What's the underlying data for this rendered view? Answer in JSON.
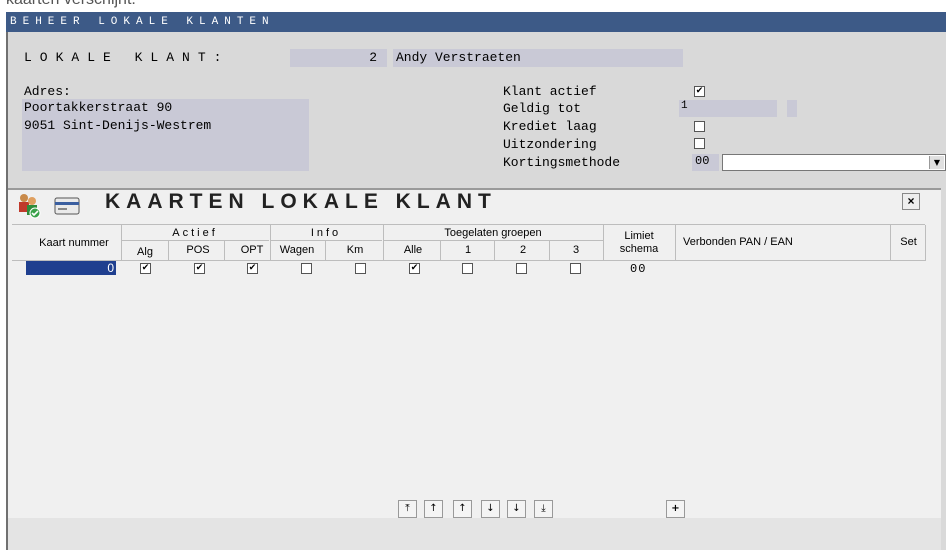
{
  "top_caption": "kaarten verschijnt.",
  "window": {
    "title": "BEHEER LOKALE KLANTEN"
  },
  "customer": {
    "label": "LOKALE KLANT:",
    "number": "2",
    "name": "Andy Verstraeten",
    "address_label": "Adres:",
    "address_line1": "Poortakkerstraat 90",
    "address_line2": "9051 Sint-Denijs-Westrem"
  },
  "flags": {
    "active_label": "Klant actief",
    "active_checked": "✔",
    "valid_until_label": "Geldig tot",
    "valid_until_value": "1",
    "credit_low_label": "Krediet laag",
    "credit_low_checked": "",
    "exception_label": "Uitzondering",
    "exception_checked": "",
    "discount_label": "Kortingsmethode",
    "discount_code": "00",
    "discount_value": ""
  },
  "cards_panel": {
    "title": "KAARTEN LOKALE KLANT",
    "close": "×",
    "headers": {
      "card_number": "Kaart nummer",
      "actief": "Actief",
      "alg": "Alg",
      "pos": "POS",
      "opt": "OPT",
      "info": "Info",
      "wagen": "Wagen",
      "km": "Km",
      "groups": "Toegelaten groepen",
      "alle": "Alle",
      "g1": "1",
      "g2": "2",
      "g3": "3",
      "limit_line1": "Limiet",
      "limit_line2": "schema",
      "linked": "Verbonden PAN / EAN",
      "set": "Set"
    },
    "rows": [
      {
        "card_number": "0",
        "alg": "✔",
        "pos": "✔",
        "opt": "✔",
        "wagen": "",
        "km": "",
        "alle": "✔",
        "g1": "",
        "g2": "",
        "g3": "",
        "limit": "00",
        "linked": "",
        "set": ""
      }
    ],
    "nav": {
      "first": "⤒",
      "prev_page": "↑",
      "prev": "↑",
      "next": "↓",
      "next_page": "↓",
      "last": "⤓",
      "add": "+"
    }
  },
  "icons": {
    "users": "users-icon",
    "card": "card-icon"
  }
}
